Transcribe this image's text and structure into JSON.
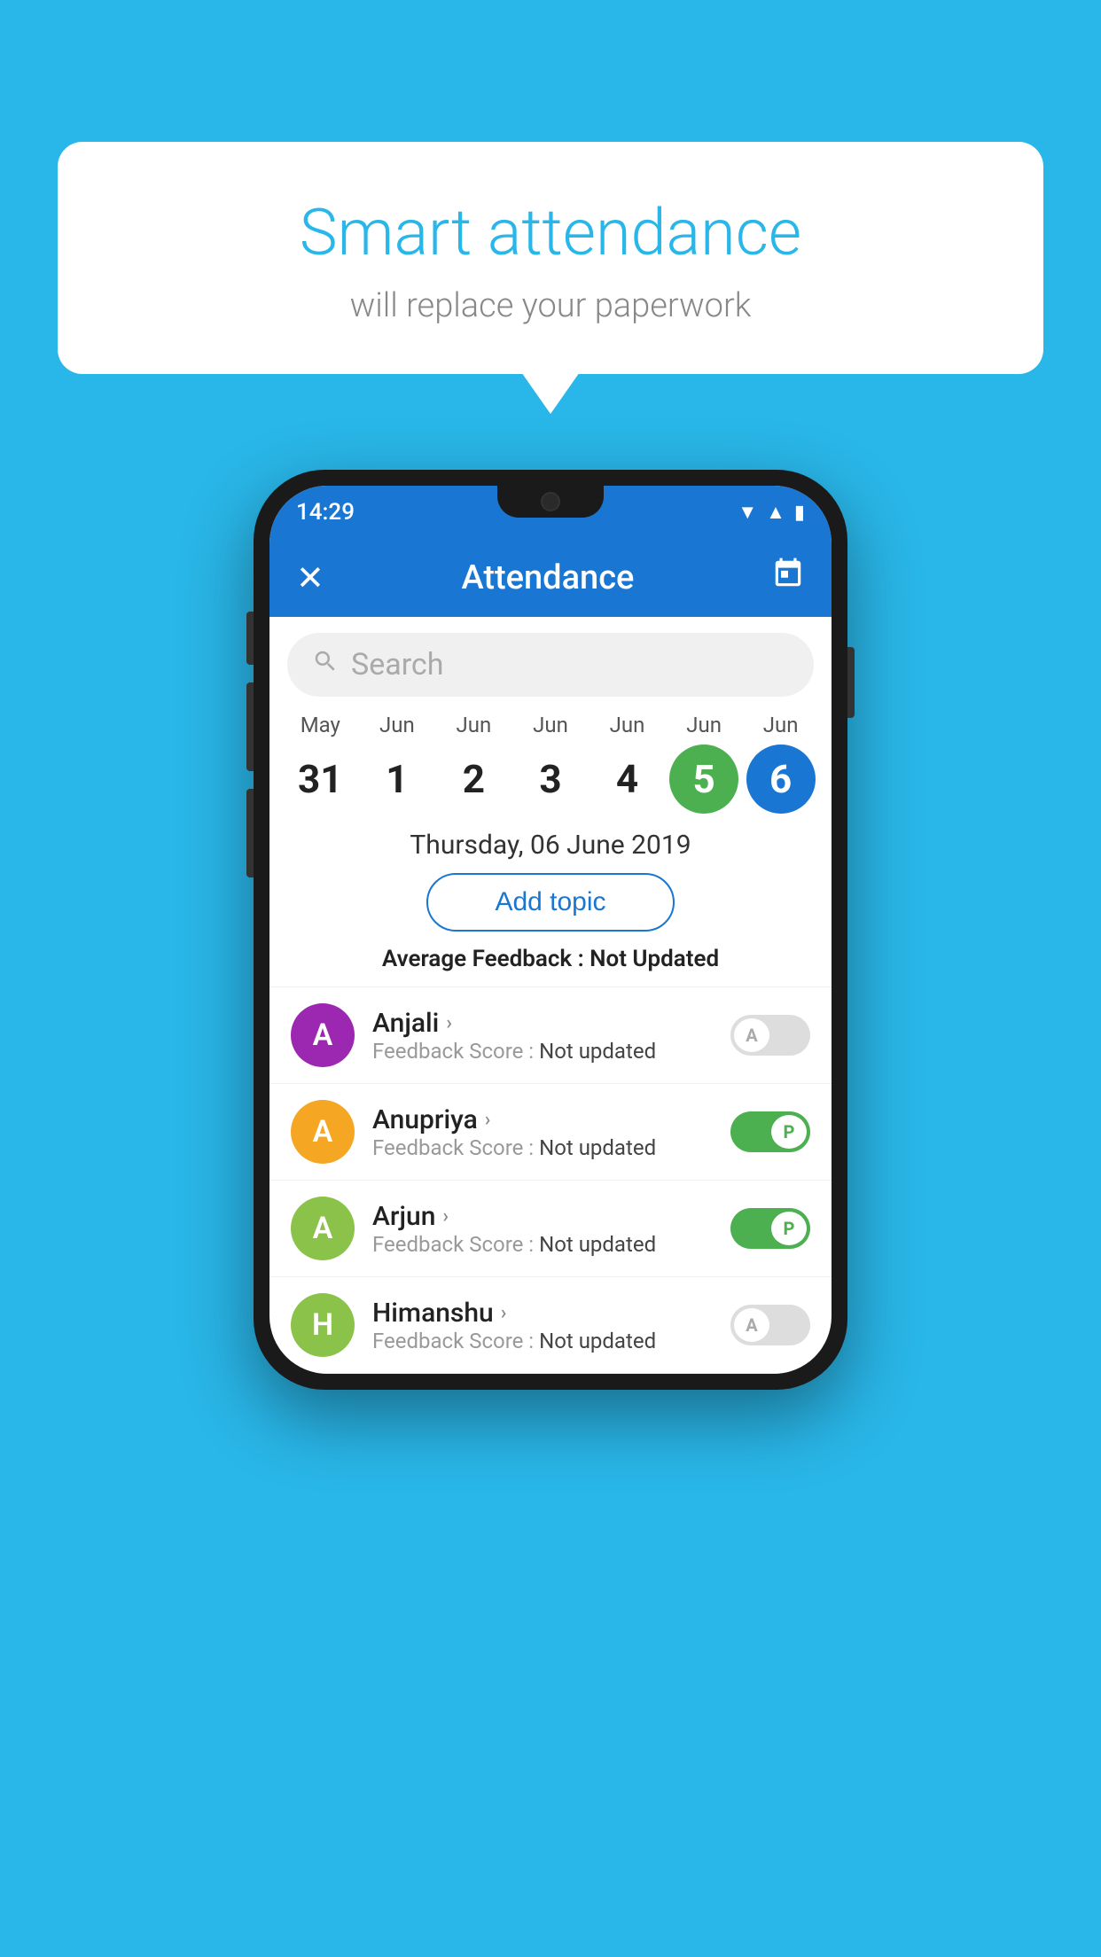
{
  "background": {
    "color": "#29b6e8"
  },
  "bubble": {
    "title": "Smart attendance",
    "subtitle": "will replace your paperwork"
  },
  "phone": {
    "status_bar": {
      "time": "14:29",
      "icons": [
        "wifi",
        "signal",
        "battery"
      ]
    },
    "header": {
      "title": "Attendance",
      "close_icon": "✕",
      "calendar_icon": "📅"
    },
    "search": {
      "placeholder": "Search"
    },
    "calendar": {
      "dates": [
        {
          "month": "May",
          "day": "31",
          "style": "normal"
        },
        {
          "month": "Jun",
          "day": "1",
          "style": "normal"
        },
        {
          "month": "Jun",
          "day": "2",
          "style": "normal"
        },
        {
          "month": "Jun",
          "day": "3",
          "style": "normal"
        },
        {
          "month": "Jun",
          "day": "4",
          "style": "normal"
        },
        {
          "month": "Jun",
          "day": "5",
          "style": "green"
        },
        {
          "month": "Jun",
          "day": "6",
          "style": "blue"
        }
      ]
    },
    "selected_date": "Thursday, 06 June 2019",
    "add_topic_label": "Add topic",
    "avg_feedback_label": "Average Feedback :",
    "avg_feedback_value": "Not Updated",
    "students": [
      {
        "name": "Anjali",
        "avatar_letter": "A",
        "avatar_color": "#9c27b0",
        "feedback_label": "Feedback Score : ",
        "feedback_value": "Not updated",
        "toggle": "off",
        "toggle_label": "A"
      },
      {
        "name": "Anupriya",
        "avatar_letter": "A",
        "avatar_color": "#f5a623",
        "feedback_label": "Feedback Score : ",
        "feedback_value": "Not updated",
        "toggle": "on",
        "toggle_label": "P"
      },
      {
        "name": "Arjun",
        "avatar_letter": "A",
        "avatar_color": "#8bc34a",
        "feedback_label": "Feedback Score : ",
        "feedback_value": "Not updated",
        "toggle": "on",
        "toggle_label": "P"
      },
      {
        "name": "Himanshu",
        "avatar_letter": "H",
        "avatar_color": "#8bc34a",
        "feedback_label": "Feedback Score : ",
        "feedback_value": "Not updated",
        "toggle": "off",
        "toggle_label": "A"
      }
    ]
  }
}
